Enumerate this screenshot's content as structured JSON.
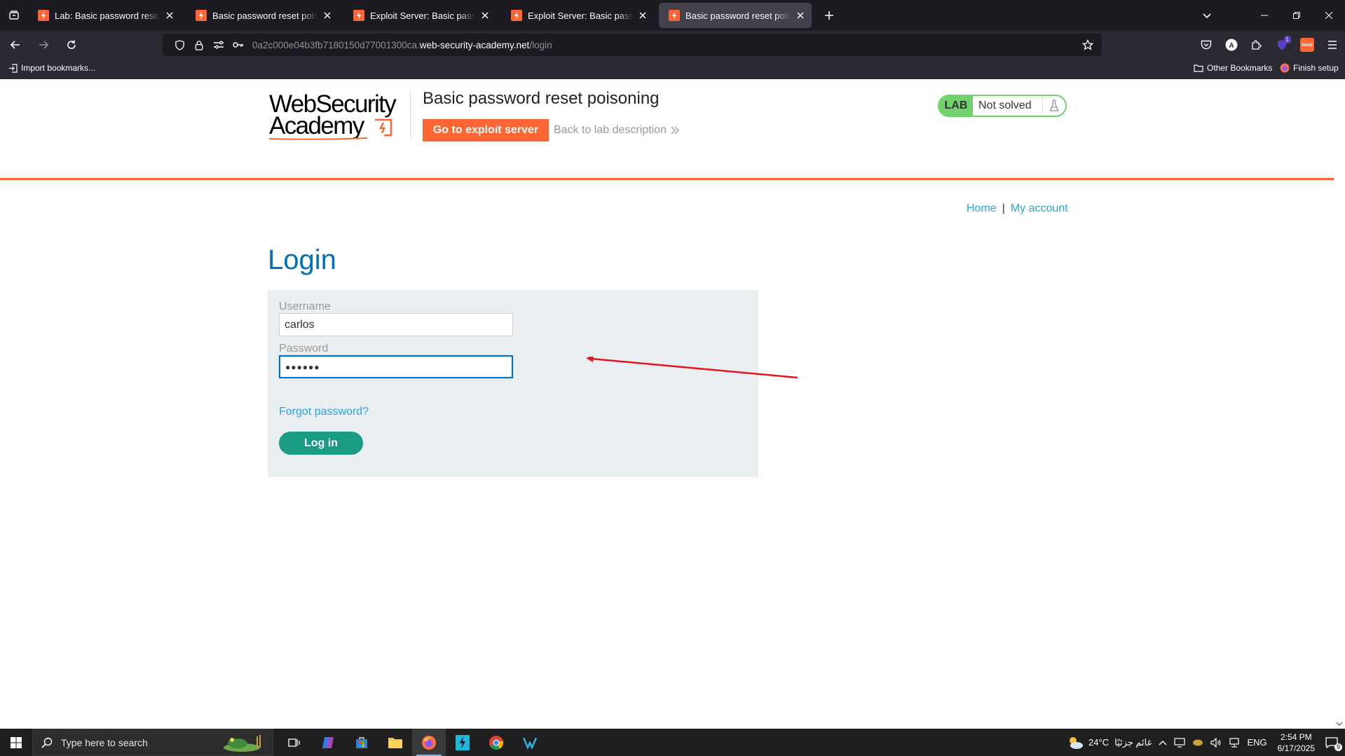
{
  "browser": {
    "tabs": [
      {
        "title": "Lab: Basic password reset poisoning",
        "active": false
      },
      {
        "title": "Basic password reset poisoning",
        "active": false
      },
      {
        "title": "Exploit Server: Basic password reset poisoning",
        "active": false
      },
      {
        "title": "Exploit Server: Basic password reset poisoning",
        "active": false
      },
      {
        "title": "Basic password reset poisoning",
        "active": true
      }
    ],
    "url": {
      "subdomain": "0a2c000e04b3fb7180150d77001300ca.",
      "host": "web-security-academy.net",
      "path": "/login"
    },
    "bookmarks": {
      "import_label": "Import bookmarks...",
      "other_label": "Other Bookmarks",
      "finish_label": "Finish setup"
    },
    "extension_badge": "1",
    "burp_label": "burp"
  },
  "header": {
    "logo_line1": "WebSecurity",
    "logo_line2": "Academy",
    "lab_title": "Basic password reset poisoning",
    "exploit_button": "Go to exploit server",
    "back_link": "Back to lab description",
    "lab_badge": "LAB",
    "status": "Not solved"
  },
  "nav": {
    "home": "Home",
    "separator": "|",
    "account": "My account"
  },
  "login": {
    "heading": "Login",
    "username_label": "Username",
    "username_value": "carlos",
    "password_label": "Password",
    "password_masked": "●●●●●●",
    "forgot": "Forgot password?",
    "submit": "Log in"
  },
  "taskbar": {
    "search_placeholder": "Type here to search",
    "weather": "24°C",
    "weather_desc": "غائم جزئيًا",
    "lang": "ENG",
    "time": "2:54 PM",
    "date": "6/17/2025",
    "notifications": "9"
  },
  "colors": {
    "brand_orange": "#ff6633",
    "heading_blue": "#0071bc",
    "link_blue": "#29a6e0",
    "button_green": "#1a9b84",
    "lab_green": "#70d16d",
    "annotation_red": "#e8141c"
  }
}
